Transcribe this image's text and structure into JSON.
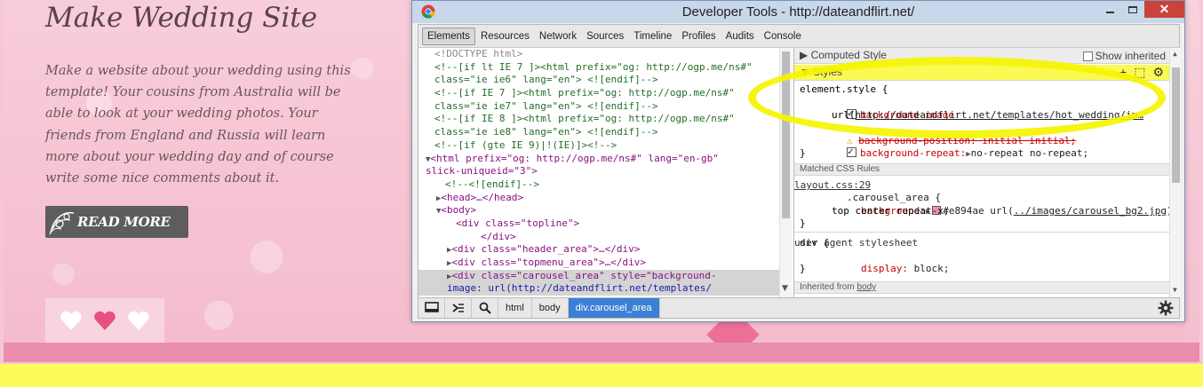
{
  "site": {
    "title": "Make Wedding Site",
    "body": "Make a website about your wedding using this template! Your cousins from Australia will be able to look at your wedding photos. Your friends from England and Russia will learn more about your wedding day and of course write some nice comments about it.",
    "read_more": "READ MORE"
  },
  "devtools": {
    "window_title": "Developer Tools - http://dateandflirt.net/",
    "close_glyph": "✕",
    "tabs": [
      "Elements",
      "Resources",
      "Network",
      "Sources",
      "Timeline",
      "Profiles",
      "Audits",
      "Console"
    ],
    "dom_lines": [
      "<!DOCTYPE html>",
      "<!--[if lt IE 7 ]><html prefix=\"og: http://ogp.me/ns#\"",
      "class=\"ie ie6\" lang=\"en\"> <![endif]-->",
      "<!--[if IE 7 ]><html prefix=\"og: http://ogp.me/ns#\"",
      "class=\"ie ie7\" lang=\"en\"> <![endif]-->",
      "<!--[if IE 8 ]><html prefix=\"og: http://ogp.me/ns#\"",
      "class=\"ie ie8\" lang=\"en\"> <![endif]-->",
      "<!--[if (gte IE 9)|!(IE)]><!-->",
      "<html prefix=\"og: http://ogp.me/ns#\" lang=\"en-gb\"",
      "slick-uniqueid=\"3\">",
      "<!--<![endif]-->",
      "<head>…</head>",
      "<body>",
      "<div class=\"topline\">",
      "</div>",
      "<div class=\"header_area\">…</div>",
      "<div class=\"topmenu_area\">…</div>",
      "<div class=\"carousel_area\" style=\"background-",
      "image: url(http://dateandflirt.net/templates/"
    ],
    "styles": {
      "computed_header": "Computed Style",
      "show_inherited": "Show inherited",
      "styles_header": "Styles",
      "element_style": "element.style {",
      "bg_image_prop": "background-image:",
      "bg_image_url": "http://dateandflirt.net/templates/hot_wedding/im…",
      "bg_position": "background-position: initial initial;",
      "bg_repeat_prop": "background-repeat:",
      "bg_repeat_val": "no-repeat no-repeat;",
      "close_brace": "}",
      "matched_header": "Matched CSS Rules",
      "carousel_selector": ".carousel_area {",
      "carousel_source": "layout.css:29",
      "carousel_bg_prop": "background:",
      "carousel_bg_color": "#e894ae",
      "carousel_bg_url": "../images/carousel_bg2.jpg",
      "carousel_bg_rest": "top center repeat-x;",
      "div_selector": "div {",
      "div_source": "user agent stylesheet",
      "div_display": "display:",
      "div_display_val": "block;",
      "inherited_prefix": "Inherited from",
      "inherited_from": "body"
    },
    "breadcrumbs": [
      "html",
      "body",
      "div.carousel_area"
    ],
    "colors": {
      "swatch": "#e894ae",
      "selected_crumb": "#3c80d5"
    }
  }
}
